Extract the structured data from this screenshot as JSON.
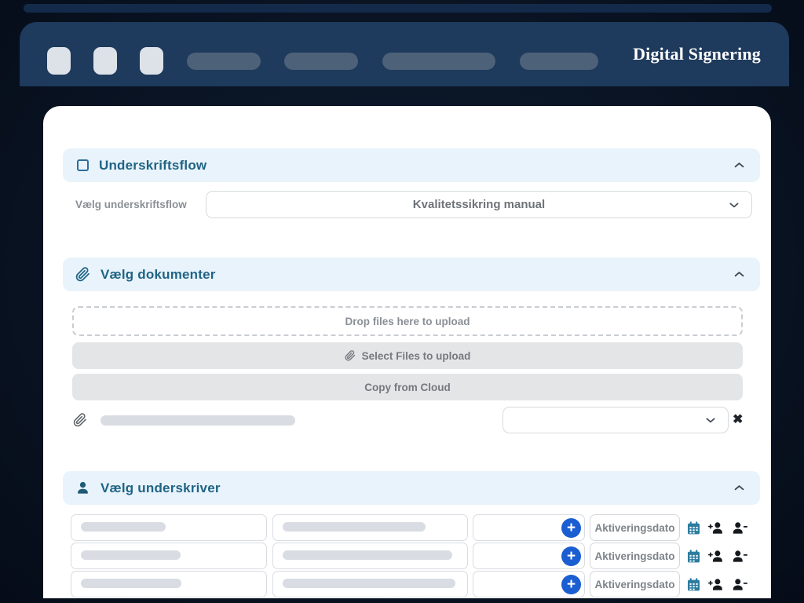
{
  "app": {
    "title": "Digital Signering"
  },
  "sections": {
    "flow": {
      "title": "Underskriftsflow",
      "select_label": "Vælg underskriftsflow",
      "selected_option": "Kvalitetssikring manual"
    },
    "documents": {
      "title": "Vælg dokumenter",
      "dropzone_text": "Drop files here to upload",
      "select_files_label": "Select Files to upload",
      "copy_cloud_label": "Copy from Cloud"
    },
    "signers": {
      "title": "Vælg underskriver",
      "activation_date_label": "Aktiveringsdato",
      "row_count": 3
    }
  },
  "icons": {
    "plus": "+",
    "close": "✖"
  },
  "colors": {
    "background_navy": "#0a1424",
    "chrome_navy": "#1e3a5c",
    "section_header_bg": "#e9f3fb",
    "section_title_teal": "#1f6485",
    "calendar_teal": "#2d7ca0",
    "plus_circle_blue": "#1a5ed2"
  }
}
